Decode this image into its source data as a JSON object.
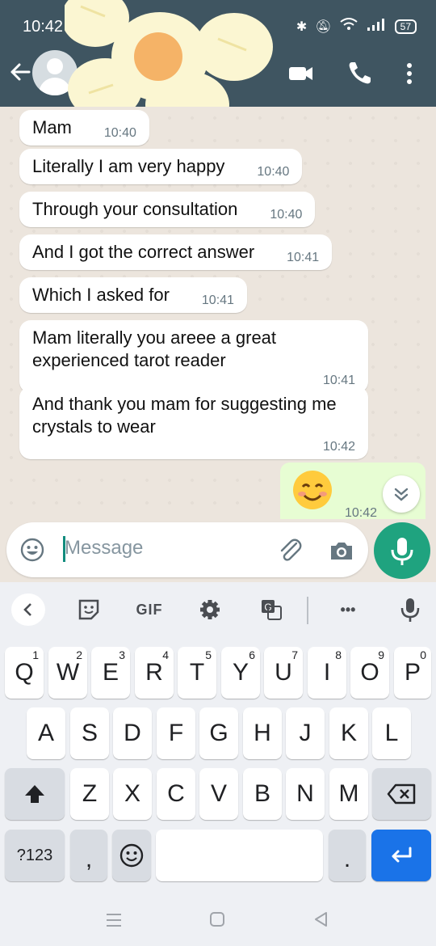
{
  "status": {
    "time": "10:42",
    "battery": "57"
  },
  "messages": [
    {
      "text": "Mam",
      "time": "10:40"
    },
    {
      "text": "Literally I am very happy",
      "time": "10:40"
    },
    {
      "text": "Through your consultation",
      "time": "10:40"
    },
    {
      "text": "And I got the correct answer",
      "time": "10:41"
    },
    {
      "text": "Which I asked for",
      "time": "10:41"
    },
    {
      "text": "Mam literally you areee a great experienced tarot reader",
      "time": "10:41"
    },
    {
      "text": "And thank you mam for suggesting me crystals to wear",
      "time": "10:42"
    }
  ],
  "outgoing": {
    "time": "10:42"
  },
  "input": {
    "placeholder": "Message"
  },
  "keyboard": {
    "toolbar": {
      "gif": "GIF",
      "more": "•••"
    },
    "row1": [
      {
        "k": "Q",
        "h": "1"
      },
      {
        "k": "W",
        "h": "2"
      },
      {
        "k": "E",
        "h": "3"
      },
      {
        "k": "R",
        "h": "4"
      },
      {
        "k": "T",
        "h": "5"
      },
      {
        "k": "Y",
        "h": "6"
      },
      {
        "k": "U",
        "h": "7"
      },
      {
        "k": "I",
        "h": "8"
      },
      {
        "k": "O",
        "h": "9"
      },
      {
        "k": "P",
        "h": "0"
      }
    ],
    "row2": [
      "A",
      "S",
      "D",
      "F",
      "G",
      "H",
      "J",
      "K",
      "L"
    ],
    "row3": [
      "Z",
      "X",
      "C",
      "V",
      "B",
      "N",
      "M"
    ],
    "row4": {
      "symbols": "?123",
      "comma": ",",
      "period": "."
    }
  }
}
